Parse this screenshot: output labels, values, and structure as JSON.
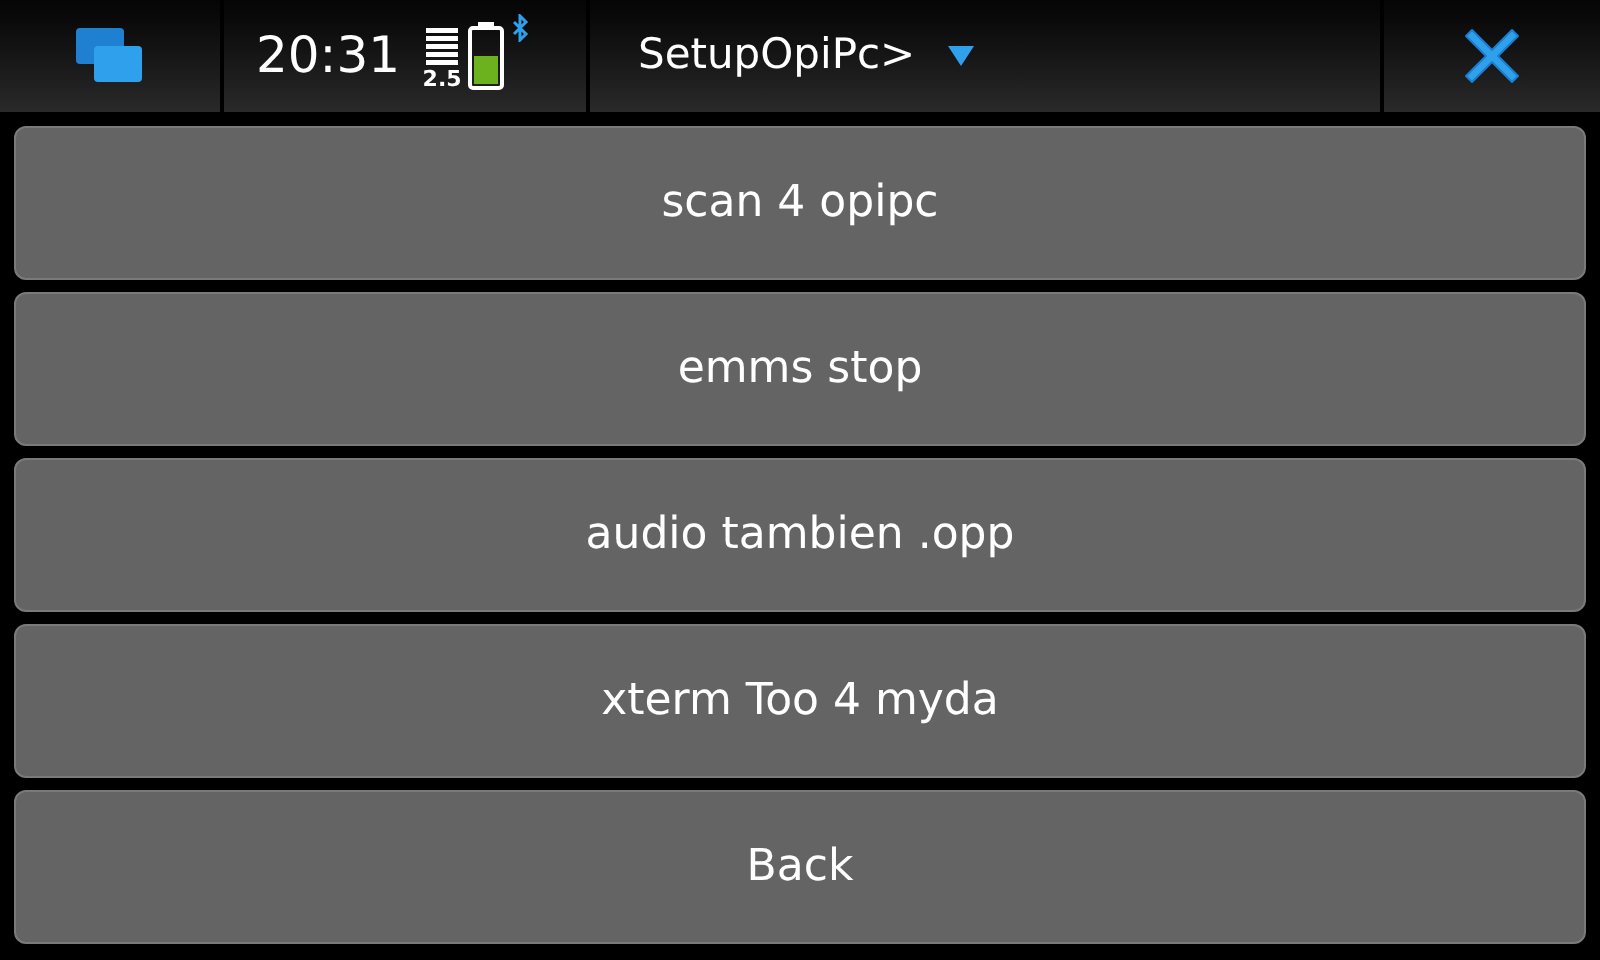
{
  "status_bar": {
    "time": "20:31",
    "network": "2.5"
  },
  "window": {
    "title": "SetupOpiPc>"
  },
  "buttons": [
    {
      "label": "scan 4 opipc"
    },
    {
      "label": "emms stop"
    },
    {
      "label": "audio tambien .opp"
    },
    {
      "label": "xterm Too 4 myda"
    },
    {
      "label": "Back"
    }
  ]
}
